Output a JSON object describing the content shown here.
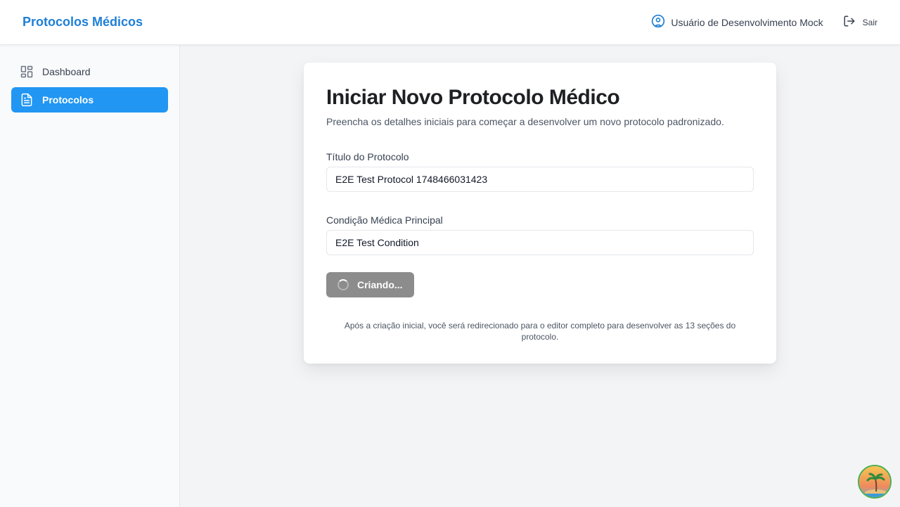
{
  "header": {
    "brand": "Protocolos Médicos",
    "user_name": "Usuário de Desenvolvimento Mock",
    "logout_label": "Sair"
  },
  "sidebar": {
    "items": [
      {
        "label": "Dashboard",
        "icon": "dashboard-grid-icon",
        "active": false
      },
      {
        "label": "Protocolos",
        "icon": "document-icon",
        "active": true
      }
    ]
  },
  "form": {
    "title": "Iniciar Novo Protocolo Médico",
    "subtitle": "Preencha os detalhes iniciais para começar a desenvolver um novo protocolo padronizado.",
    "protocol_title_label": "Título do Protocolo",
    "protocol_title_value": "E2E Test Protocol 1748466031423",
    "condition_label": "Condição Médica Principal",
    "condition_value": "E2E Test Condition",
    "submit_label": "Criando...",
    "footnote": "Após a criação inicial, você será redirecionado para o editor completo para desenvolver as 13 seções do protocolo."
  },
  "colors": {
    "brand": "#1e7fd6",
    "active_nav": "#2196f3",
    "button_disabled": "#8c8c8c"
  }
}
